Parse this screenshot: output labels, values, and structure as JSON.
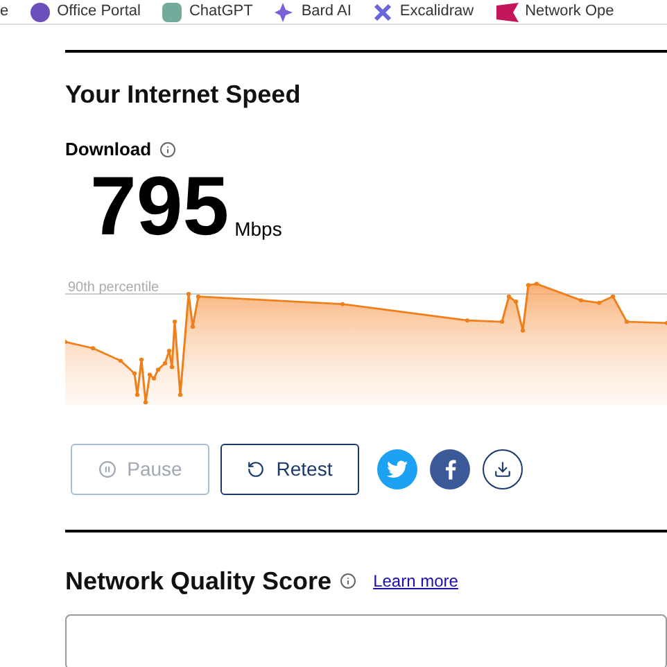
{
  "bookmarks": [
    {
      "label": "e"
    },
    {
      "label": "Office Portal"
    },
    {
      "label": "ChatGPT"
    },
    {
      "label": "Bard AI"
    },
    {
      "label": "Excalidraw"
    },
    {
      "label": "Network Ope"
    }
  ],
  "speed": {
    "title": "Your Internet Speed",
    "metric": "Download",
    "value": "795",
    "unit": "Mbps",
    "percentile_label": "90th percentile"
  },
  "buttons": [
    {
      "label": "Pause",
      "kind": "pause",
      "disabled": true
    },
    {
      "label": "Retest",
      "kind": "retest",
      "disabled": false
    }
  ],
  "share": [
    {
      "kind": "twitter"
    },
    {
      "kind": "facebook"
    },
    {
      "kind": "download"
    }
  ],
  "quality": {
    "title": "Network Quality Score",
    "link": "Learn more"
  }
}
